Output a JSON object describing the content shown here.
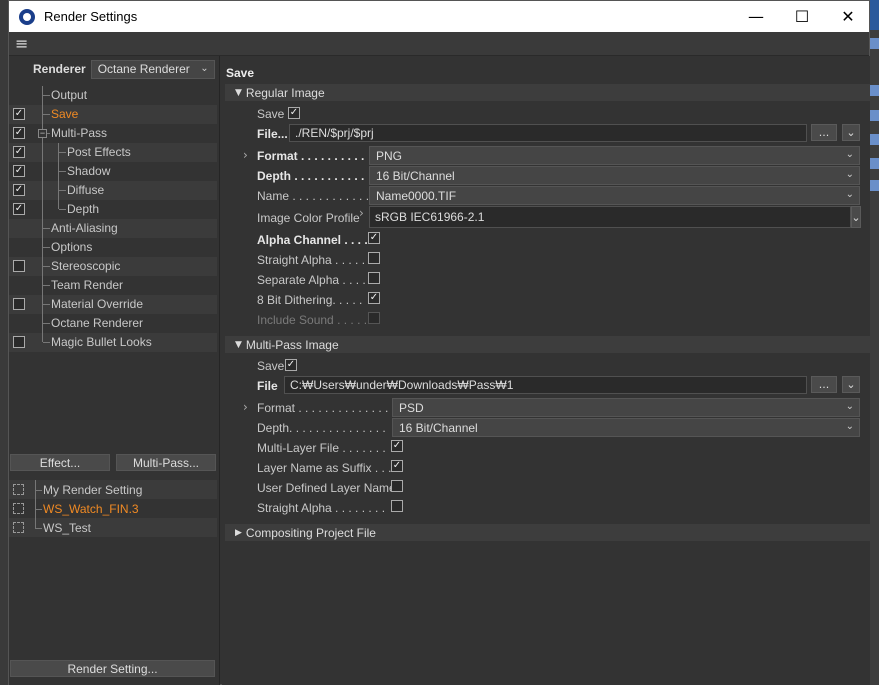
{
  "window": {
    "title": "Render Settings"
  },
  "left": {
    "renderer_label": "Renderer",
    "renderer_value": "Octane Renderer",
    "tree": [
      {
        "label": "Output",
        "checkbox": false,
        "checked": false,
        "active": false
      },
      {
        "label": "Save",
        "checkbox": true,
        "checked": true,
        "active": true
      },
      {
        "label": "Multi-Pass",
        "checkbox": true,
        "checked": true,
        "active": false
      },
      {
        "label": "Post Effects",
        "checkbox": true,
        "checked": true,
        "active": false
      },
      {
        "label": "Shadow",
        "checkbox": true,
        "checked": true,
        "active": false
      },
      {
        "label": "Diffuse",
        "checkbox": true,
        "checked": true,
        "active": false
      },
      {
        "label": "Depth",
        "checkbox": true,
        "checked": true,
        "active": false
      },
      {
        "label": "Anti-Aliasing",
        "checkbox": false,
        "checked": false,
        "active": false
      },
      {
        "label": "Options",
        "checkbox": false,
        "checked": false,
        "active": false
      },
      {
        "label": "Stereoscopic",
        "checkbox": true,
        "checked": false,
        "active": false
      },
      {
        "label": "Team Render",
        "checkbox": false,
        "checked": false,
        "active": false
      },
      {
        "label": "Material Override",
        "checkbox": true,
        "checked": false,
        "active": false
      },
      {
        "label": "Octane Renderer",
        "checkbox": false,
        "checked": false,
        "active": false
      },
      {
        "label": "Magic Bullet Looks",
        "checkbox": true,
        "checked": false,
        "active": false
      }
    ],
    "effect_btn": "Effect...",
    "multipass_btn": "Multi-Pass...",
    "settings": [
      {
        "label": "My Render Setting",
        "active": false
      },
      {
        "label": "WS_Watch_FIN.3",
        "active": true
      },
      {
        "label": "WS_Test",
        "active": false
      }
    ],
    "render_setting_btn": "Render Setting..."
  },
  "right": {
    "section": "Save",
    "regular": {
      "header": "Regular Image",
      "save_label": "Save",
      "save_checked": true,
      "file_label": "File...",
      "file_value": "./REN/$prj/$prj",
      "file_btn": "...",
      "format_label": "Format . . . . . . . . . .",
      "format_value": "PNG",
      "depth_label": "Depth . . . . . . . . . . .",
      "depth_value": "16 Bit/Channel",
      "name_label": "Name . . . . . . . . . . . .",
      "name_value": "Name0000.TIF",
      "profile_label": "Image Color Profile",
      "profile_value": "sRGB IEC61966-2.1",
      "alpha_label": "Alpha Channel . . . .",
      "alpha_checked": true,
      "straight_label": "Straight Alpha . . . . .",
      "straight_checked": false,
      "separate_label": "Separate Alpha . . . .",
      "separate_checked": false,
      "dither_label": "8 Bit Dithering. . . . .",
      "dither_checked": true,
      "sound_label": "Include Sound . . . . .",
      "sound_checked": false
    },
    "multipass": {
      "header": "Multi-Pass Image",
      "save_label": "Save",
      "save_checked": true,
      "file_label": "File",
      "file_value": "C:₩Users₩under₩Downloads₩Pass₩1",
      "file_btn": "...",
      "format_label": "Format . . . . . . . . . . . . . .",
      "format_value": "PSD",
      "depth_label": "Depth. . . . . . . . . . . . . . .",
      "depth_value": "16 Bit/Channel",
      "multilayer_label": "Multi-Layer File . . . . . . .",
      "multilayer_checked": true,
      "layername_label": "Layer Name as Suffix . . .",
      "layername_checked": true,
      "userdef_label": "User Defined Layer Name",
      "userdef_checked": false,
      "straight_label": "Straight Alpha . . . . . . . .",
      "straight_checked": false
    },
    "compositing_header": "Compositing Project File"
  },
  "colors": {
    "accent": "#f08a24",
    "panel": "#333333",
    "titlebar": "#ffffff",
    "desktop": "#2b5a9c"
  }
}
